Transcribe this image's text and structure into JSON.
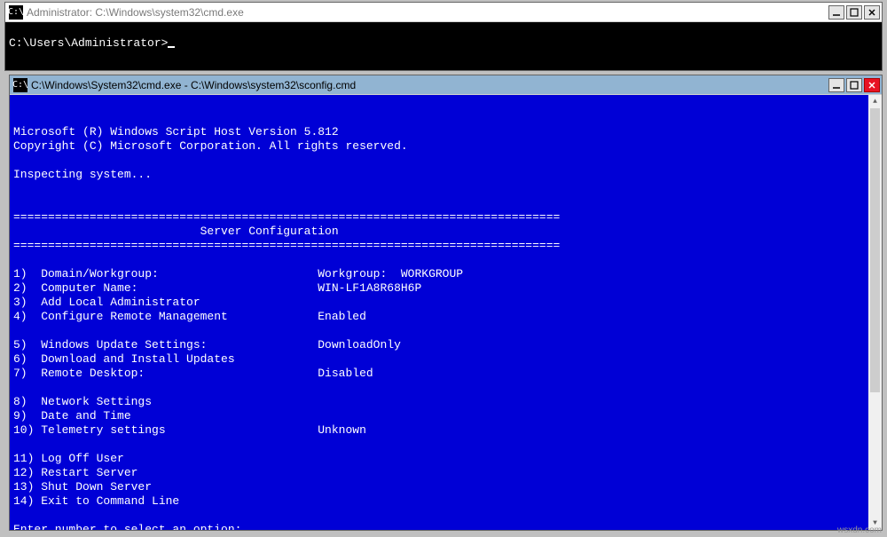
{
  "watermark": "wsxdn.com",
  "window1": {
    "title": "Administrator: C:\\Windows\\system32\\cmd.exe",
    "prompt": "C:\\Users\\Administrator>"
  },
  "window2": {
    "title": "C:\\Windows\\System32\\cmd.exe - C:\\Windows\\system32\\sconfig.cmd",
    "header_line1": "Microsoft (R) Windows Script Host Version 5.812",
    "header_line2": "Copyright (C) Microsoft Corporation. All rights reserved.",
    "inspecting": "Inspecting system...",
    "divider": "===============================================================================",
    "section_title": "                           Server Configuration",
    "items": [
      {
        "n": "1)",
        "label": "Domain/Workgroup:",
        "value": "Workgroup:  WORKGROUP"
      },
      {
        "n": "2)",
        "label": "Computer Name:",
        "value": "WIN-LF1A8R68H6P"
      },
      {
        "n": "3)",
        "label": "Add Local Administrator",
        "value": ""
      },
      {
        "n": "4)",
        "label": "Configure Remote Management",
        "value": "Enabled"
      },
      {
        "n": "",
        "label": "",
        "value": ""
      },
      {
        "n": "5)",
        "label": "Windows Update Settings:",
        "value": "DownloadOnly"
      },
      {
        "n": "6)",
        "label": "Download and Install Updates",
        "value": ""
      },
      {
        "n": "7)",
        "label": "Remote Desktop:",
        "value": "Disabled"
      },
      {
        "n": "",
        "label": "",
        "value": ""
      },
      {
        "n": "8)",
        "label": "Network Settings",
        "value": ""
      },
      {
        "n": "9)",
        "label": "Date and Time",
        "value": ""
      },
      {
        "n": "10)",
        "label": "Telemetry settings",
        "value": "Unknown"
      },
      {
        "n": "",
        "label": "",
        "value": ""
      },
      {
        "n": "11)",
        "label": "Log Off User",
        "value": ""
      },
      {
        "n": "12)",
        "label": "Restart Server",
        "value": ""
      },
      {
        "n": "13)",
        "label": "Shut Down Server",
        "value": ""
      },
      {
        "n": "14)",
        "label": "Exit to Command Line",
        "value": ""
      }
    ],
    "prompt": "Enter number to select an option:"
  }
}
